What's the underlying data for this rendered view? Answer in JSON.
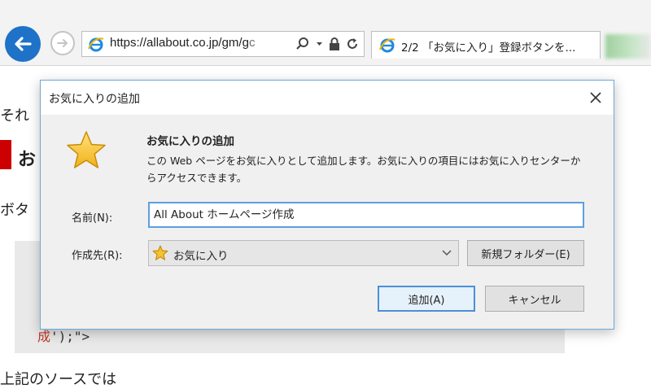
{
  "browser": {
    "address_url_main": "https://allabout.co.jp/gm/g",
    "address_url_faded": "c",
    "tab_title": "2/2 「お気に入り」登録ボタンを...",
    "colors": {
      "back_button": "#1e72c8",
      "ie_icon": "#1e88e5",
      "accent_border": "#4a90d9"
    }
  },
  "page": {
    "text_line1": "それ",
    "text_heading_frag": "お",
    "text_line3": "ボタ",
    "code_fragment_red": "成",
    "code_fragment_rest": "');\">",
    "text_bottom": "上記のソースでは"
  },
  "dialog": {
    "title": "お気に入りの追加",
    "heading": "お気に入りの追加",
    "description": "この Web ページをお気に入りとして追加します。お気に入りの項目にはお気に入りセンターからアクセスできます。",
    "name_label": "名前(N):",
    "name_value": "All About ホームページ作成",
    "dest_label": "作成先(R):",
    "dest_value": "お気に入り",
    "new_folder_button": "新規フォルダー(E)",
    "add_button": "追加(A)",
    "cancel_button": "キャンセル",
    "icons": {
      "star": "favorites-star-icon",
      "close": "close-icon",
      "chevron": "chevron-down-icon"
    }
  }
}
